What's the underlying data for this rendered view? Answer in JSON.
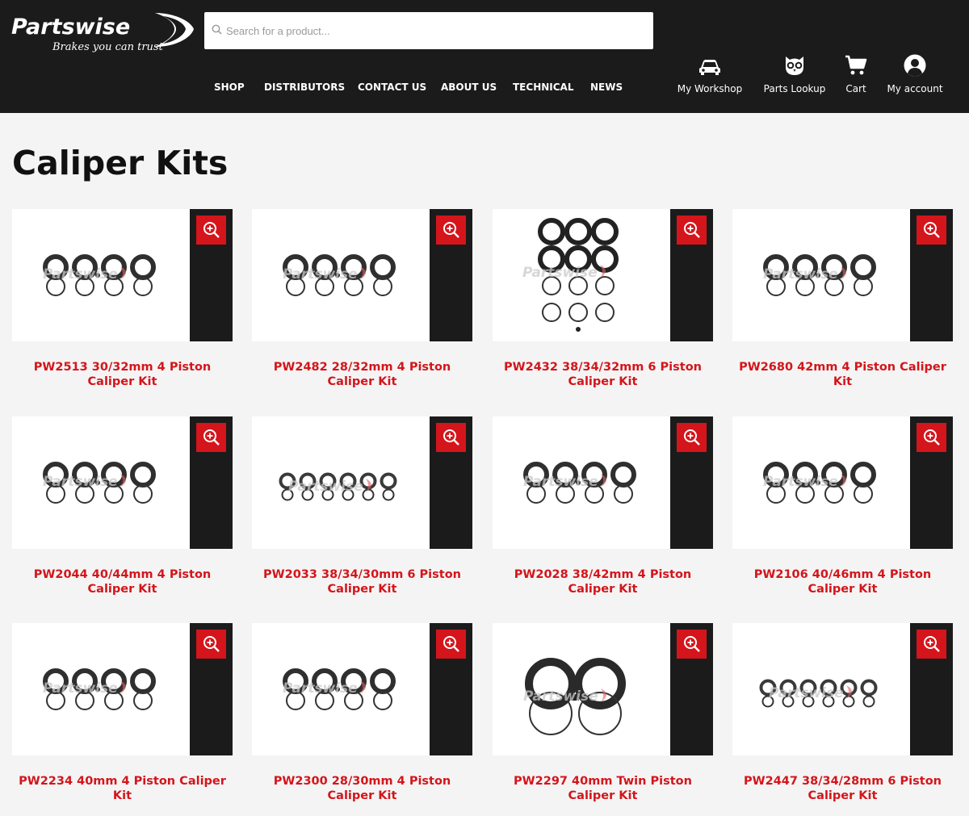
{
  "header": {
    "logo_text": "Partswise",
    "logo_tagline": "Brakes you can trust",
    "search_placeholder": "Search for a product...",
    "nav": [
      "SHOP",
      "DISTRIBUTORS",
      "CONTACT US",
      "ABOUT US",
      "TECHNICAL",
      "NEWS"
    ],
    "utilities": [
      {
        "label": "My Workshop",
        "icon": "car-icon"
      },
      {
        "label": "Parts Lookup",
        "icon": "owl-icon"
      },
      {
        "label": "Cart",
        "icon": "cart-icon"
      },
      {
        "label": "My account",
        "icon": "user-icon"
      }
    ]
  },
  "page": {
    "title": "Caliper Kits"
  },
  "products": [
    {
      "title": "PW2513 30/32mm 4 Piston Caliper Kit",
      "image": "caliper-kit-4-piston"
    },
    {
      "title": "PW2482 28/32mm 4 Piston Caliper Kit",
      "image": "caliper-kit-4-piston"
    },
    {
      "title": "PW2432 38/34/32mm 6 Piston Caliper Kit",
      "image": "caliper-kit-6-piston"
    },
    {
      "title": "PW2680 42mm 4 Piston Caliper Kit",
      "image": "caliper-kit-4-piston"
    },
    {
      "title": "PW2044 40/44mm 4 Piston Caliper Kit",
      "image": "caliper-kit-4-piston"
    },
    {
      "title": "PW2033 38/34/30mm 6 Piston Caliper Kit",
      "image": "caliper-kit-6-piston"
    },
    {
      "title": "PW2028 38/42mm 4 Piston Caliper Kit",
      "image": "caliper-kit-4-piston"
    },
    {
      "title": "PW2106 40/46mm 4 Piston Caliper Kit",
      "image": "caliper-kit-4-piston"
    },
    {
      "title": "PW2234 40mm 4 Piston Caliper Kit",
      "image": "caliper-kit-4-piston"
    },
    {
      "title": "PW2300 28/30mm 4 Piston Caliper Kit",
      "image": "caliper-kit-4-piston"
    },
    {
      "title": "PW2297 40mm Twin Piston Caliper Kit",
      "image": "caliper-kit-2-piston"
    },
    {
      "title": "PW2447 38/34/28mm 6 Piston Caliper Kit",
      "image": "caliper-kit-6-piston"
    }
  ],
  "colors": {
    "header_bg": "#1b1b1b",
    "accent_red": "#d4151b",
    "page_bg": "#f4f4f4"
  }
}
